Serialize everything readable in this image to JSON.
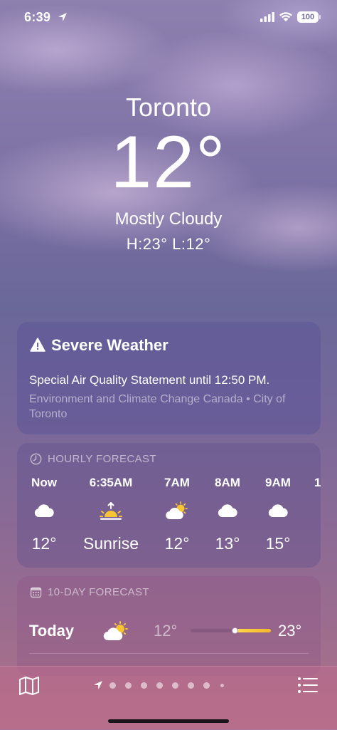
{
  "status_bar": {
    "time": "6:39",
    "battery": "100"
  },
  "location": {
    "city": "Toronto",
    "temperature": "12°",
    "condition": "Mostly Cloudy",
    "hi_lo": "H:23°  L:12°"
  },
  "alert": {
    "title": "Severe Weather",
    "text": "Special Air Quality Statement until 12:50 PM.",
    "source": "Environment and Climate Change Canada • City of Toronto",
    "icon": "warning-triangle-icon"
  },
  "hourly": {
    "header": "HOURLY FORECAST",
    "icon": "clock-icon",
    "items": [
      {
        "time": "Now",
        "icon": "cloud-icon",
        "temp": "12°"
      },
      {
        "time": "6:35AM",
        "icon": "sunrise-icon",
        "temp": "Sunrise"
      },
      {
        "time": "7AM",
        "icon": "partly-cloudy-icon",
        "temp": "12°"
      },
      {
        "time": "8AM",
        "icon": "cloud-icon",
        "temp": "13°"
      },
      {
        "time": "9AM",
        "icon": "cloud-icon",
        "temp": "15°"
      },
      {
        "time": "1",
        "icon": "cloud-icon",
        "temp": ""
      }
    ]
  },
  "daily": {
    "header": "10-DAY FORECAST",
    "icon": "calendar-icon",
    "days": [
      {
        "day": "Today",
        "icon": "partly-cloudy-icon",
        "low": "12°",
        "high": "23°",
        "range_start": 0.55,
        "range_end": 1.0,
        "current": 0.55
      }
    ]
  },
  "bottom_bar": {
    "map_icon": "map-icon",
    "list_icon": "list-icon",
    "page_count": 9,
    "current_page": 0
  },
  "colors": {
    "temp_bar_warm": "#f5b82a",
    "battery_text": "#6f6a9e"
  }
}
